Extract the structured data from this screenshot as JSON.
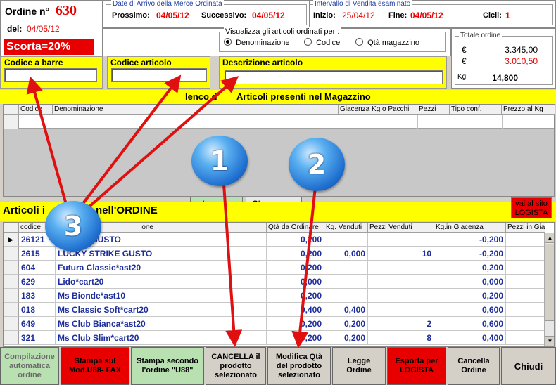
{
  "order": {
    "label": "Ordine n°",
    "number": "630",
    "date_label": "del:",
    "date": "04/05/12",
    "stock_badge": "Scorta=20%"
  },
  "arrival": {
    "title": "Date di Arrivo della Merce Ordinata",
    "next_label": "Prossimo:",
    "next_value": "04/05/12",
    "following_label": "Successivo:",
    "following_value": "04/05/12"
  },
  "interval": {
    "title": "Intervallo di Vendita esaminato",
    "start_label": "Inizio:",
    "start_value": "25/04/12",
    "end_label": "Fine:",
    "end_value": "04/05/12",
    "cycles_label": "Cicli:",
    "cycles_value": "1"
  },
  "view_by": {
    "title": "Visualizza gli articoli ordinati per :",
    "options": [
      "Denominazione",
      "Codice",
      "Qtà magazzino"
    ],
    "selected": "Denominazione"
  },
  "totals": {
    "title": "Totale ordine",
    "currency1": "€",
    "value1": "3.345,00",
    "currency2": "€",
    "value2": "3.010,50",
    "kg_label": "Kg",
    "kg_value": "14,800"
  },
  "search": {
    "barcode_label": "Codice a barre",
    "barcode_value": "",
    "code_label": "Codice articolo",
    "code_value": "",
    "desc_label": "Descrizione articolo",
    "desc_value": ""
  },
  "warehouse": {
    "title_pre": "lenco d",
    "title_post": "Articoli presenti nel Magazzino",
    "columns": [
      "Codice",
      "Denominazione",
      "Giacenza Kg o Pacchi",
      "Pezzi",
      "Tipo conf.",
      "Prezzo al Kg"
    ]
  },
  "mid_buttons": {
    "import": "Importa patentino",
    "print_internal": "Stampa per uso interno",
    "logista_site": "vai al sito LOGISTA"
  },
  "order_section": {
    "title_left": "Articoli i",
    "title_right": "nell'ORDINE",
    "columns": [
      "codice",
      "one",
      "Qtà da Ordinare",
      "Kg. Venduti",
      "Pezzi Venduti",
      "Kg.in Giacenza",
      "Pezzi in Gia"
    ],
    "rows": [
      {
        "code": "26121",
        "name": "STRIKE GUSTO",
        "qty": "0,200",
        "kgsold": "",
        "pcssold": "",
        "kgstock": "-0,200",
        "current": true
      },
      {
        "code": "2615",
        "name": "LUCKY STRIKE GUSTO",
        "qty": "0,200",
        "kgsold": "0,000",
        "pcssold": "10",
        "kgstock": "-0,200",
        "current": false
      },
      {
        "code": "604",
        "name": "Futura Classic*ast20",
        "qty": "0,200",
        "kgsold": "",
        "pcssold": "",
        "kgstock": "0,200",
        "current": false
      },
      {
        "code": "629",
        "name": "Lido*cart20",
        "qty": "0,000",
        "kgsold": "",
        "pcssold": "",
        "kgstock": "0,000",
        "current": false
      },
      {
        "code": "183",
        "name": "Ms Bionde*ast10",
        "qty": "0,200",
        "kgsold": "",
        "pcssold": "",
        "kgstock": "0,200",
        "current": false
      },
      {
        "code": "018",
        "name": "Ms Classic Soft*cart20",
        "qty": "0,400",
        "kgsold": "0,400",
        "pcssold": "",
        "kgstock": "0,600",
        "current": false
      },
      {
        "code": "649",
        "name": "Ms Club Bianca*ast20",
        "qty": "0,200",
        "kgsold": "0,200",
        "pcssold": "2",
        "kgstock": "0,600",
        "current": false
      },
      {
        "code": "321",
        "name": "Ms Club Slim*cart20",
        "qty": "0,200",
        "kgsold": "0,200",
        "pcssold": "8",
        "kgstock": "0,400",
        "current": false
      }
    ]
  },
  "bottom_buttons": [
    {
      "label": "Compilazione automatica ordine",
      "color": "#b9e0b0",
      "textcolor": "#6a6a6a",
      "name": "auto-order-button"
    },
    {
      "label": "Stampa sul Mod.U88- FAX",
      "color": "#e80000",
      "textcolor": "#000000",
      "name": "print-u88-fax-button"
    },
    {
      "label": "Stampa secondo l'ordine \"U88\"",
      "color": "#b9e0b0",
      "textcolor": "#000000",
      "name": "print-u88-order-button"
    },
    {
      "label": "CANCELLA il prodotto selezionato",
      "color": "#d4d0c8",
      "textcolor": "#000000",
      "name": "delete-product-button"
    },
    {
      "label": "Modifica Qtà del prodotto selezionato",
      "color": "#d4d0c8",
      "textcolor": "#000000",
      "name": "edit-qty-button"
    },
    {
      "label": "Legge Ordine",
      "color": "#d4d0c8",
      "textcolor": "#000000",
      "name": "read-order-button"
    },
    {
      "label": "Esporta per LOGISTA",
      "color": "#e80000",
      "textcolor": "#000000",
      "name": "export-logista-button"
    },
    {
      "label": "Cancella Ordine",
      "color": "#d4d0c8",
      "textcolor": "#000000",
      "name": "delete-order-button"
    },
    {
      "label": "Chiudi",
      "color": "#d4d0c8",
      "textcolor": "#000000",
      "name": "close-button"
    }
  ],
  "annotations": {
    "b1": "1",
    "b2": "2",
    "b3": "3"
  },
  "colors": {
    "accent_red": "#e80000",
    "highlight_yellow": "#ffff00",
    "row_text_blue": "#1c2d9c",
    "arrow_red": "#e01010"
  }
}
